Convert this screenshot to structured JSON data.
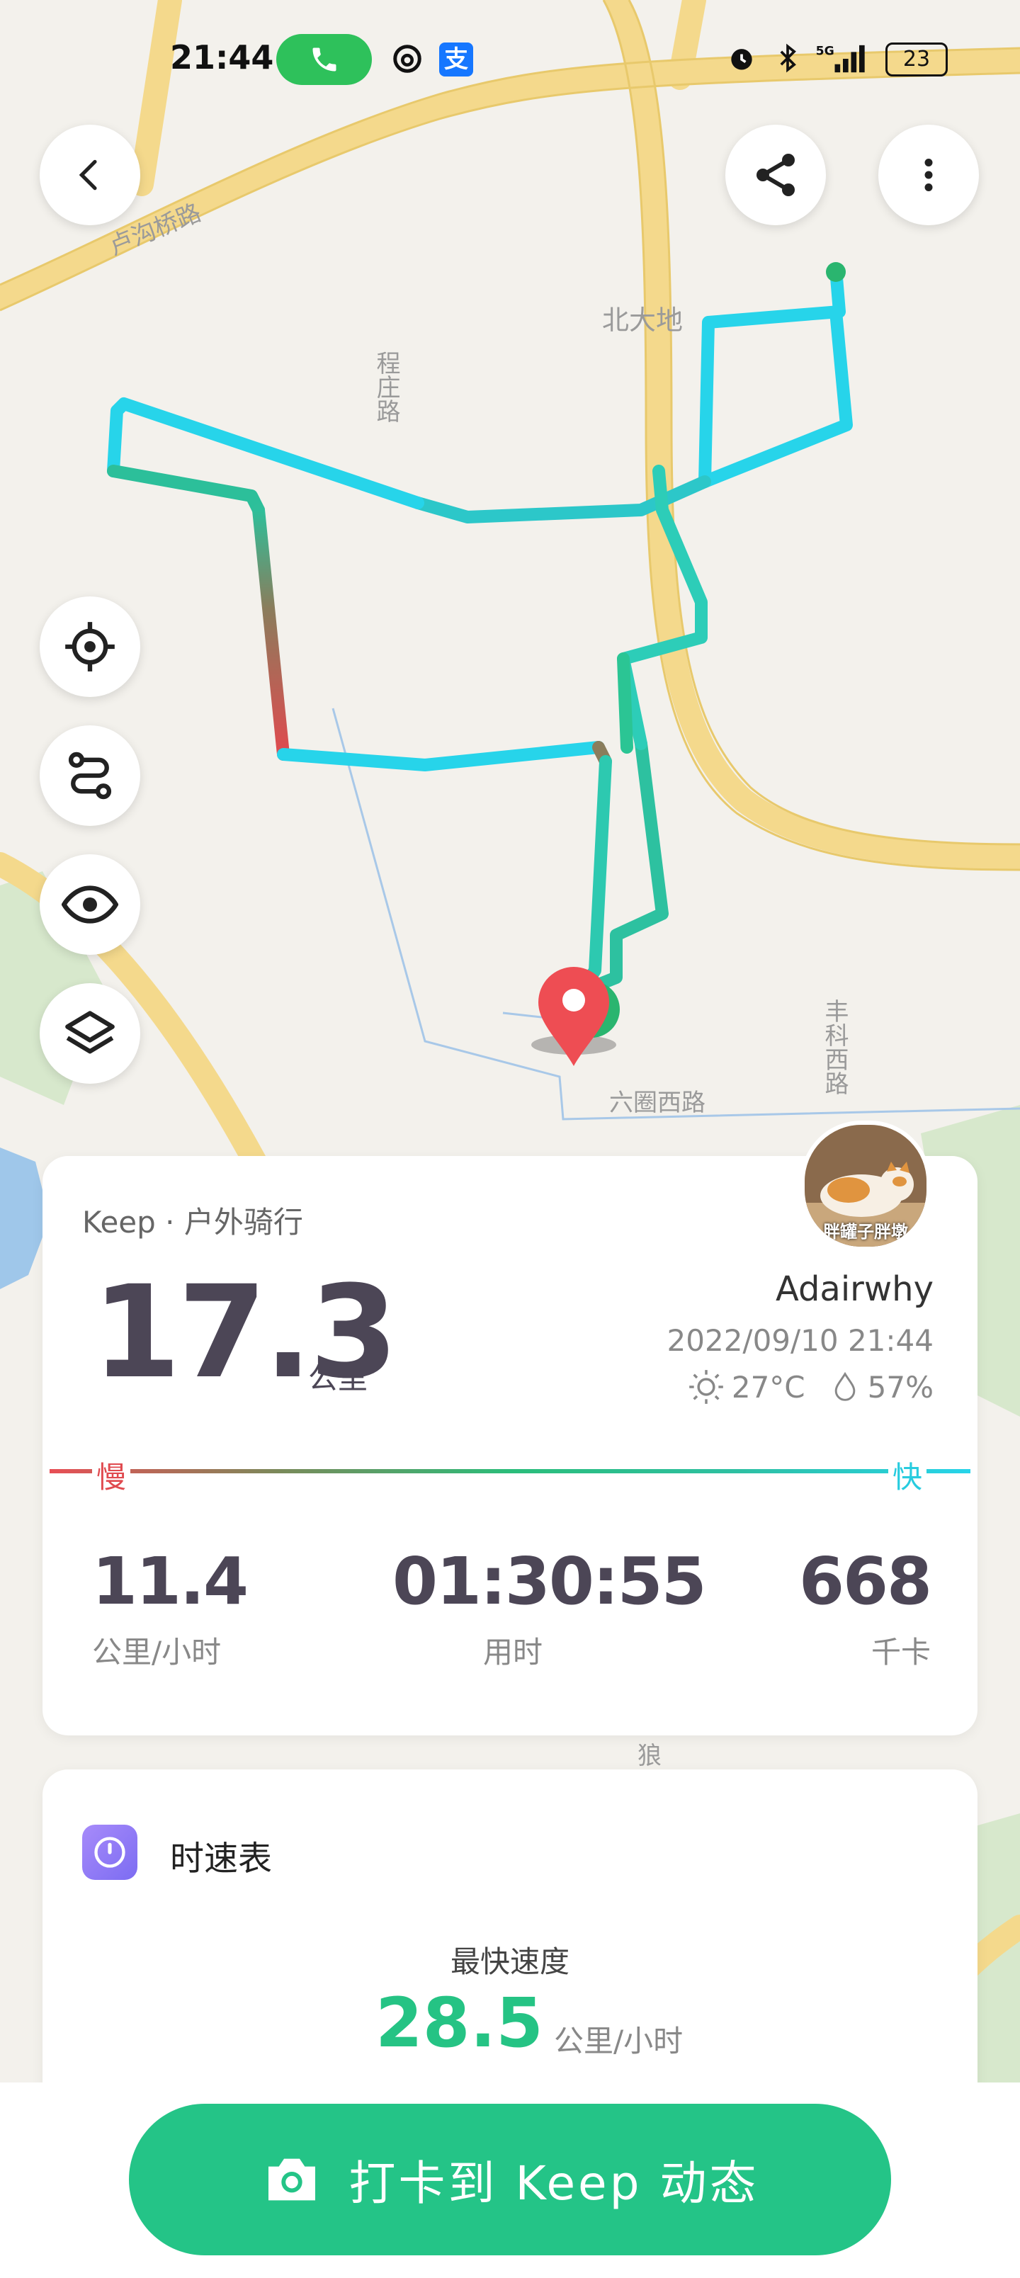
{
  "status_bar": {
    "time": "21:44",
    "battery": "23",
    "network": "5G"
  },
  "map": {
    "labels": {
      "road_1": "卢沟桥路",
      "road_2": "程庄路",
      "place_1": "北大地",
      "road_3": "丰科西路",
      "road_4": "六圈西路",
      "fragment_1": "狼"
    }
  },
  "activity": {
    "label": "Keep · 户外骑行",
    "distance": "17.3",
    "distance_unit": "公里",
    "username": "Adairwhy",
    "datetime": "2022/09/10 21:44",
    "temperature": "27°C",
    "humidity": "57%",
    "slow_label": "慢",
    "fast_label": "快",
    "avatar_caption": "胖罐子胖墩",
    "stats": [
      {
        "value": "11.4",
        "label": "公里/小时"
      },
      {
        "value": "01:30:55",
        "label": "用时"
      },
      {
        "value": "668",
        "label": "千卡"
      }
    ]
  },
  "speedometer": {
    "title": "时速表",
    "max_speed_label": "最快速度",
    "max_speed_value": "28.5",
    "max_speed_unit": "公里/小时"
  },
  "cta": {
    "label": "打卡到 Keep 动态"
  },
  "colors": {
    "accent": "#24c487",
    "route_fast": "#27d4ea",
    "route_slow": "#e04a4f"
  }
}
